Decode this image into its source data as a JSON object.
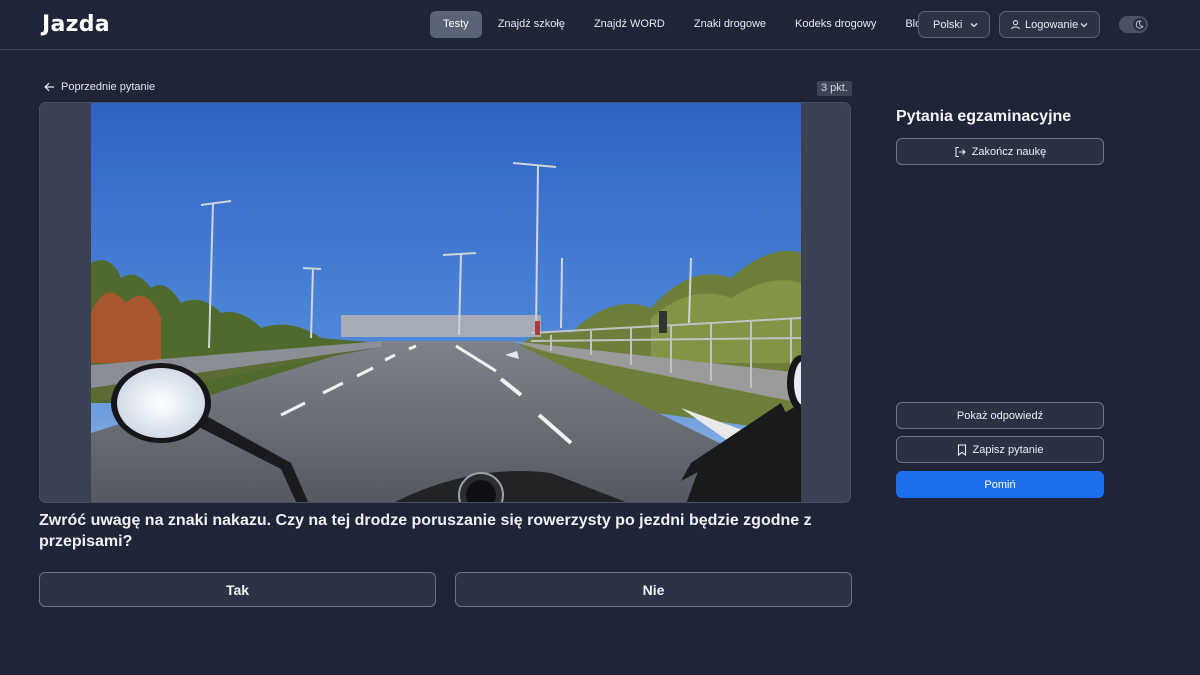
{
  "brand": {
    "logo": "Jazda",
    "accent": "#3b82f6"
  },
  "nav": {
    "items": [
      {
        "label": "Testy",
        "active": true
      },
      {
        "label": "Znajdź szkołę",
        "active": false
      },
      {
        "label": "Znajdź WORD",
        "active": false
      },
      {
        "label": "Znaki drogowe",
        "active": false
      },
      {
        "label": "Kodeks drogowy",
        "active": false
      },
      {
        "label": "Blog",
        "active": false
      }
    ],
    "language": "Polski",
    "login": "Logowanie",
    "theme_toggle_icon": "moon-icon"
  },
  "question": {
    "prev_label": "Poprzednie pytanie",
    "points": "3 pkt.",
    "text": "Zwróć uwagę na znaki nakazu. Czy na tej drodze poruszanie się rowerzysty po jezdni będzie zgodne z przepisami?",
    "answers": [
      "Tak",
      "Nie"
    ]
  },
  "sidebar": {
    "title": "Pytania egzaminacyjne",
    "end_label": "Zakończ naukę",
    "show_answer_label": "Pokaż odpowiedź",
    "save_label": "Zapisz pytanie",
    "skip_label": "Pomiń"
  },
  "colors": {
    "background": "#1f2536",
    "primary_button": "#1c6fec",
    "active_tab": "#5b6476"
  }
}
